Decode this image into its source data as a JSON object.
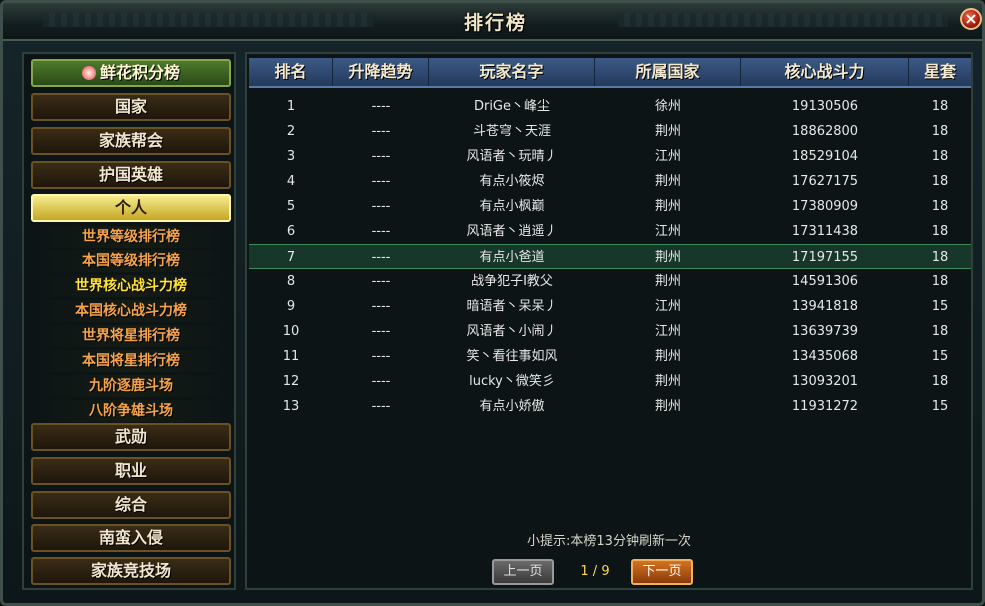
{
  "window": {
    "title": "排行榜"
  },
  "sidebar": {
    "flower_label": "鲜花积分榜",
    "categories": [
      "国家",
      "家族帮会",
      "护国英雄",
      "个人",
      "武勋",
      "职业",
      "综合",
      "南蛮入侵",
      "家族竞技场"
    ],
    "active_category": "个人",
    "sub_items": [
      "世界等级排行榜",
      "本国等级排行榜",
      "世界核心战斗力榜",
      "本国核心战斗力榜",
      "世界将星排行榜",
      "本国将星排行榜",
      "九阶逐鹿斗场",
      "八阶争雄斗场"
    ],
    "active_sub_item": "世界核心战斗力榜"
  },
  "table": {
    "columns": [
      "排名",
      "升降趋势",
      "玩家名字",
      "所属国家",
      "核心战斗力",
      "星套"
    ],
    "rows": [
      [
        "1",
        "----",
        "DriGe丶峰尘",
        "徐州",
        "19130506",
        "18"
      ],
      [
        "2",
        "----",
        "斗苍穹丶天涯",
        "荆州",
        "18862800",
        "18"
      ],
      [
        "3",
        "----",
        "风语者丶玩晴丿",
        "江州",
        "18529104",
        "18"
      ],
      [
        "4",
        "----",
        "有点小筱烬",
        "荆州",
        "17627175",
        "18"
      ],
      [
        "5",
        "----",
        "有点小枫巅",
        "荆州",
        "17380909",
        "18"
      ],
      [
        "6",
        "----",
        "风语者丶逍遥丿",
        "江州",
        "17311438",
        "18"
      ],
      [
        "7",
        "----",
        "有点小爸道",
        "荆州",
        "17197155",
        "18"
      ],
      [
        "8",
        "----",
        "战争犯子I教父",
        "荆州",
        "14591306",
        "18"
      ],
      [
        "9",
        "----",
        "暗语者丶呆呆丿",
        "江州",
        "13941818",
        "15"
      ],
      [
        "10",
        "----",
        "风语者丶小闹丿",
        "江州",
        "13639739",
        "18"
      ],
      [
        "11",
        "----",
        "笑丶看往事如风",
        "荆州",
        "13435068",
        "15"
      ],
      [
        "12",
        "----",
        "lucky丶微笑彡",
        "荆州",
        "13093201",
        "18"
      ],
      [
        "13",
        "----",
        "有点小娇傲",
        "荆州",
        "11931272",
        "15"
      ]
    ],
    "highlighted_rank": "7"
  },
  "footer": {
    "tip": "小提示:本榜13分钟刷新一次",
    "prev_label": "上一页",
    "page_indicator": "1 / 9",
    "next_label": "下一页"
  },
  "colors": {
    "header_blue": "#2f4a72",
    "active_button_gold": "#e6d35a",
    "sub_item_orange": "#f6a44c",
    "sub_item_active_yellow": "#ffe23c",
    "highlight_row_green": "#17372a",
    "next_button_orange": "#c45f16"
  },
  "icons": {
    "close": "close-icon",
    "flower": "flower-icon"
  }
}
